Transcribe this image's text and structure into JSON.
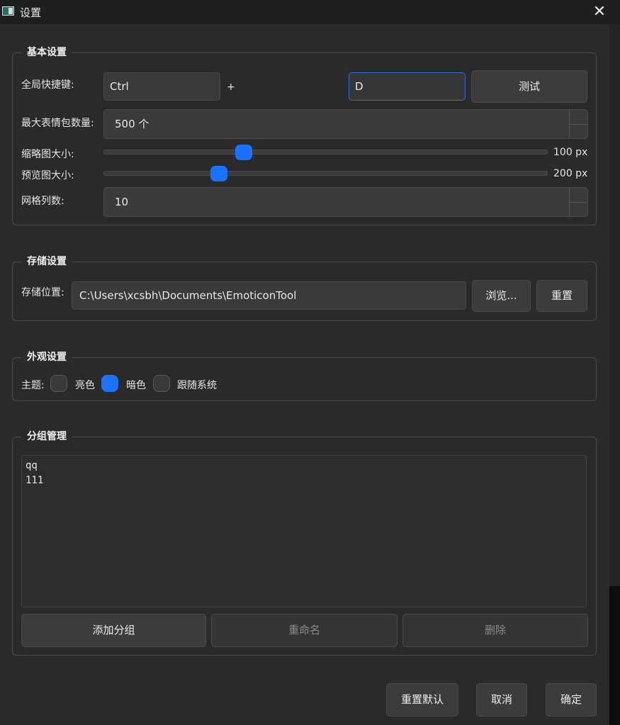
{
  "window": {
    "title": "设置",
    "close_symbol": "✕"
  },
  "basic": {
    "title": "基本设置",
    "hotkey_label": "全局快捷键:",
    "modifier_value": "Ctrl",
    "plus": "+",
    "key_value": "D",
    "test_button": "测试",
    "max_label": "最大表情包数量:",
    "max_value": "500 个",
    "thumb_label": "缩略图大小:",
    "thumb_value": "100 px",
    "thumb_level": 0.315,
    "preview_label": "预览图大小:",
    "preview_value": "200 px",
    "preview_level": 0.26,
    "grid_label": "网格列数:",
    "grid_value": "10"
  },
  "storage": {
    "title": "存储设置",
    "location_label": "存储位置:",
    "path_value": "C:\\Users\\xcsbh\\Documents\\EmoticonTool",
    "browse_button": "浏览...",
    "reset_button": "重置"
  },
  "appearance": {
    "title": "外观设置",
    "theme_label": "主题:",
    "options": [
      "亮色",
      "暗色",
      "跟随系统"
    ],
    "selected": "暗色"
  },
  "groups": {
    "title": "分组管理",
    "items": [
      "qq",
      "111"
    ],
    "add_button": "添加分组",
    "rename_button": "重命名",
    "delete_button": "删除"
  },
  "footer": {
    "reset_default": "重置默认",
    "cancel": "取消",
    "ok": "确定"
  },
  "colors": {
    "accent": "#1a73ff",
    "background": "#2a2a2a",
    "focus_border": "#2f6fd0"
  }
}
